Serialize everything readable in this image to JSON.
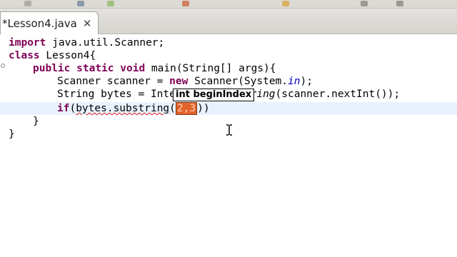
{
  "editor_tab": {
    "title": "*Lesson4.java",
    "close_glyph": "✕"
  },
  "code": {
    "line1": {
      "kw": "import",
      "rest": " java.util.Scanner;"
    },
    "line2": {
      "kw": "class",
      "rest": " Lesson4{"
    },
    "line3": {
      "kw1": "public",
      "kw2": "static",
      "kw3": "void",
      "rest": " main(String[] args){"
    },
    "line4": {
      "pre": "Scanner scanner = ",
      "kw": "new",
      "mid": " Scanner(System.",
      "field": "in",
      "post": ");"
    },
    "line5": {
      "pre": "String bytes = Inte",
      "italic": "tring",
      "post": "(scanner.nextInt());"
    },
    "line6": {
      "kw": "if",
      "pre": "(",
      "err": "bytes.substring",
      "open": "(",
      "param": "2,3",
      "close": "))"
    },
    "line7": {
      "text": "}"
    },
    "line8": {
      "text": "}"
    }
  },
  "tooltip": {
    "text": "int beginIndex"
  },
  "colors": {
    "keyword": "#7f0055",
    "field": "#0000c0",
    "current_line": "#e8f2fe",
    "param_highlight": "#e2632a"
  }
}
